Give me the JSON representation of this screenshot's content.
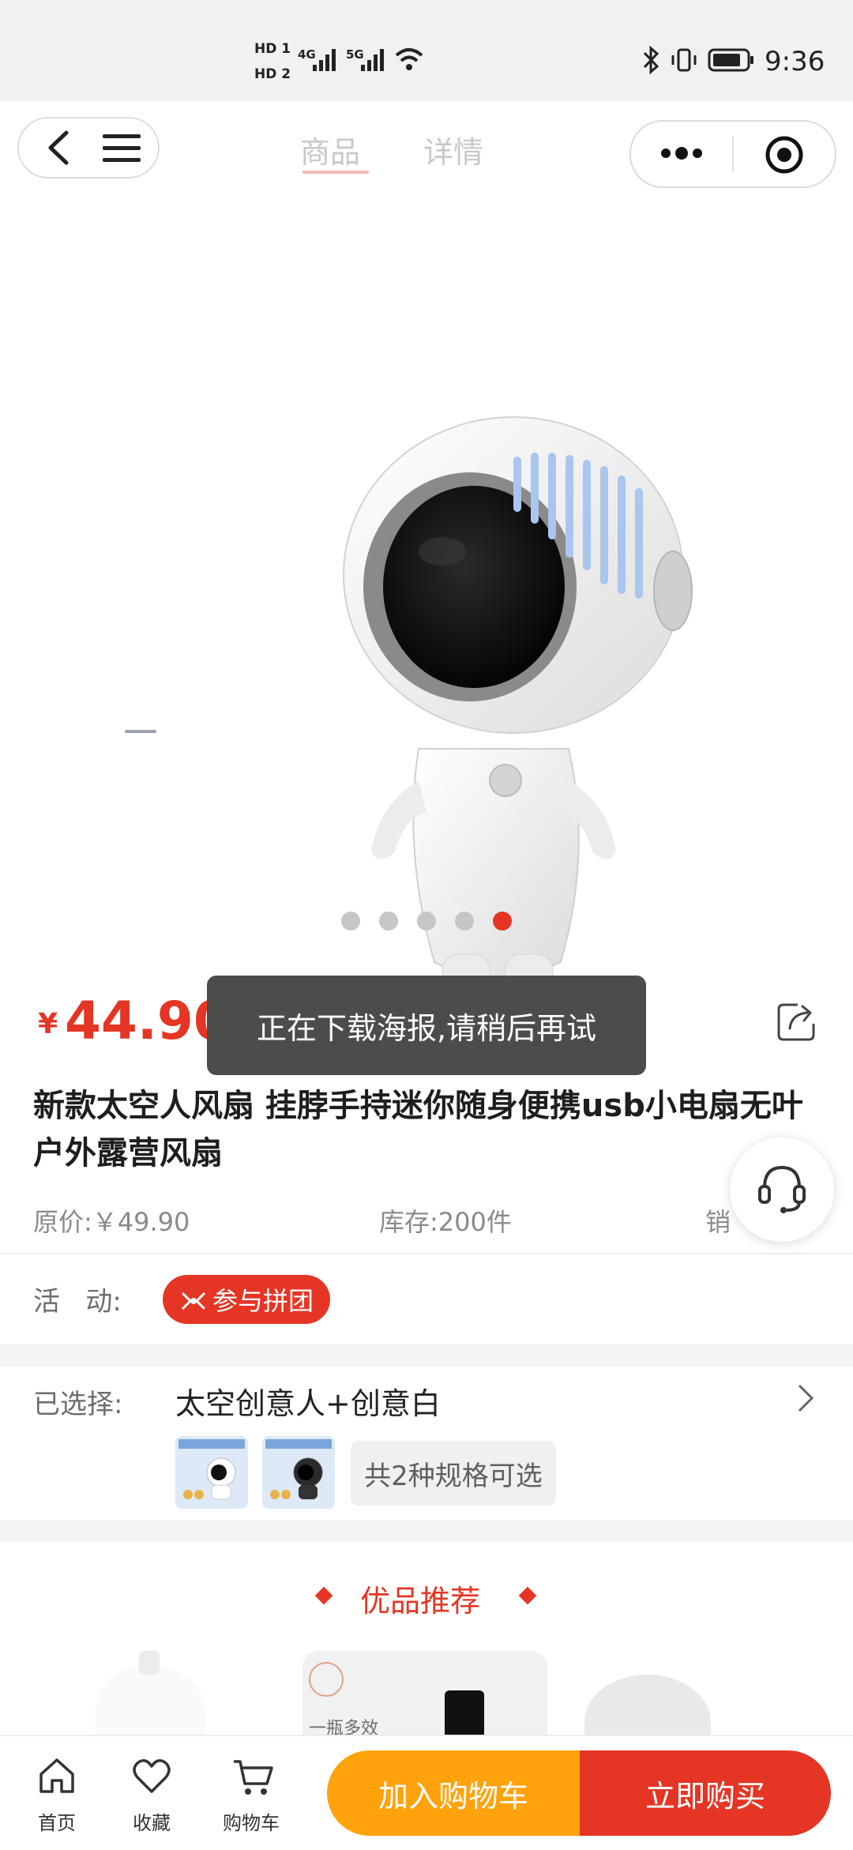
{
  "statusbar": {
    "hd1": "HD 1",
    "hd2": "HD 2",
    "net1": "4G",
    "net2": "5G",
    "time": "9:36"
  },
  "nav": {
    "tabs": [
      {
        "label": "商品"
      },
      {
        "label": "详情"
      }
    ]
  },
  "gallery": {
    "total": 5,
    "active_index": 4
  },
  "product": {
    "currency": "¥",
    "price": "44.90",
    "title": "新款太空人风扇 挂脖手持迷你随身便携usb小电扇无叶户外露营风扇",
    "original_price": "原价:￥49.90",
    "stock": "库存:200件",
    "sales": "销量"
  },
  "toast": {
    "text": "正在下载海报,请稍后再试"
  },
  "promotion": {
    "label": "活   动:",
    "badge": "参与拼团"
  },
  "selection": {
    "label": "已选择:",
    "value": "太空创意人+创意白",
    "spec_count": "共2种规格可选"
  },
  "recommend": {
    "title": "优品推荐",
    "card_text": "一瓶多效"
  },
  "bottom": {
    "home": "首页",
    "favorite": "收藏",
    "cart": "购物车",
    "add_to_cart": "加入购物车",
    "buy_now": "立即购买"
  },
  "colors": {
    "accent_red": "#e53524",
    "accent_orange": "#ffa20b"
  }
}
